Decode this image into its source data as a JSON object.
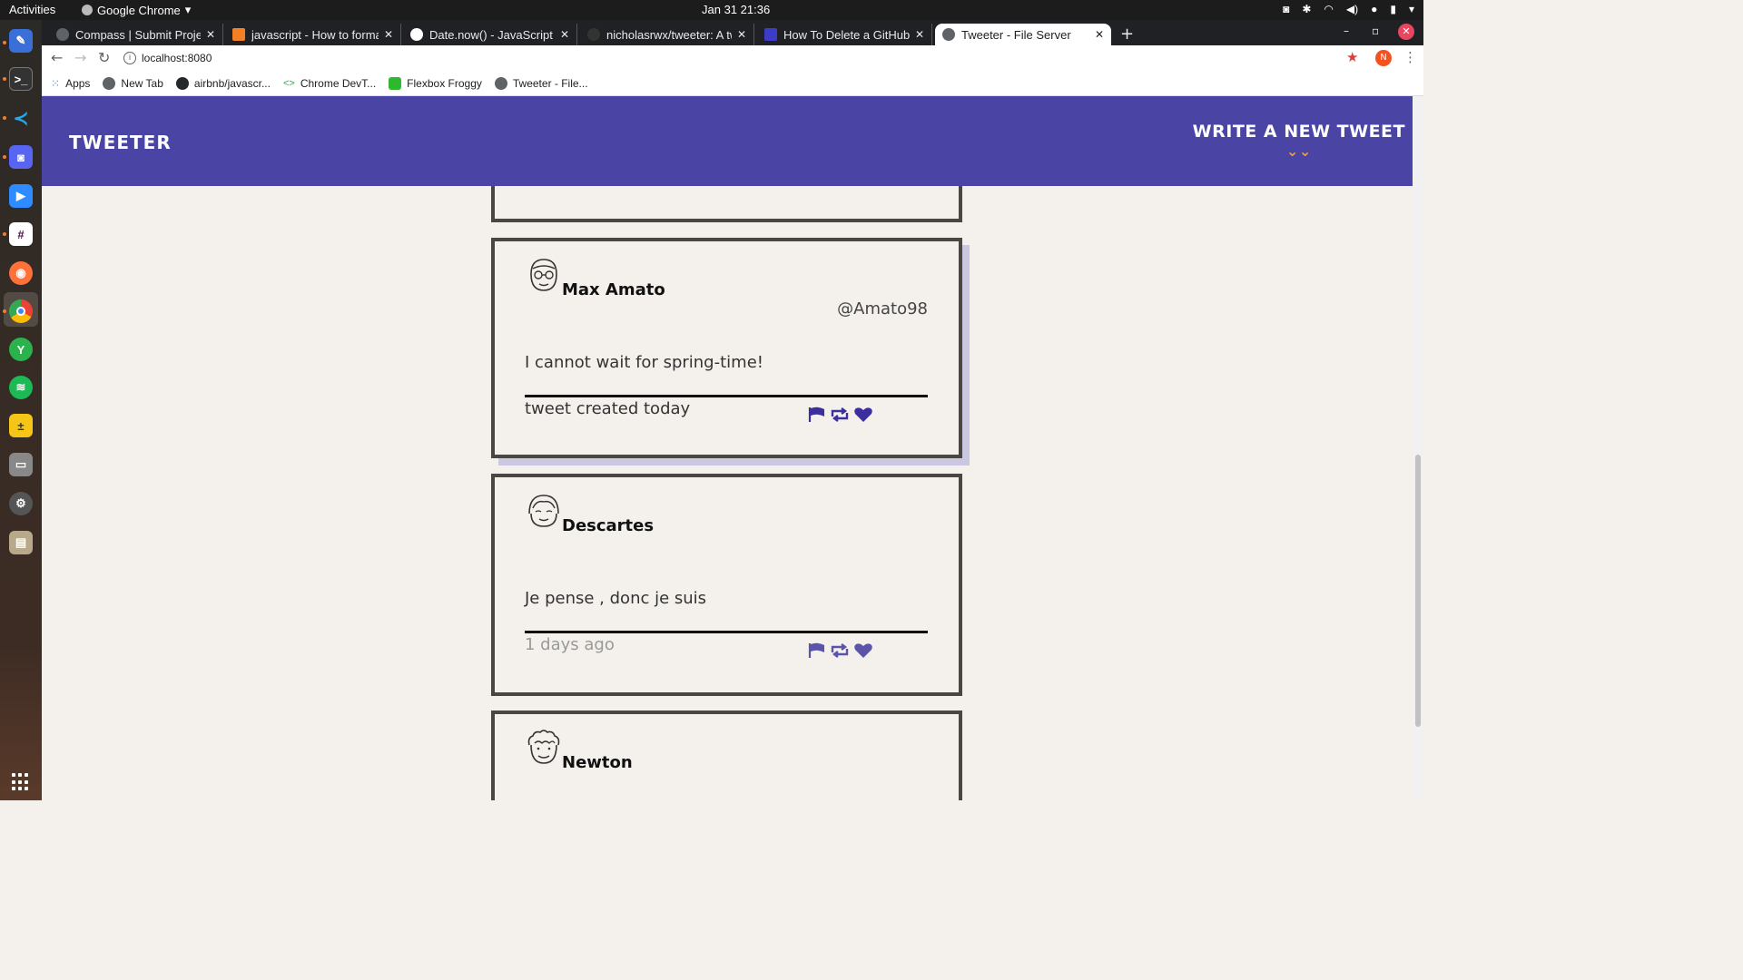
{
  "os": {
    "activities": "Activities",
    "app_name": "Google Chrome",
    "clock": "Jan 31  21:36"
  },
  "browser": {
    "tabs": [
      {
        "title": "Compass | Submit Project"
      },
      {
        "title": "javascript - How to format"
      },
      {
        "title": "Date.now() - JavaScript | M"
      },
      {
        "title": "nicholasrwx/tweeter: A tw"
      },
      {
        "title": "How To Delete a GitHub R"
      },
      {
        "title": "Tweeter - File Server"
      }
    ],
    "url": "localhost:8080",
    "profile_initial": "N",
    "bookmarks": [
      {
        "label": "Apps"
      },
      {
        "label": "New Tab"
      },
      {
        "label": "airbnb/javascr..."
      },
      {
        "label": "Chrome DevT..."
      },
      {
        "label": "Flexbox Froggy"
      },
      {
        "label": "Tweeter - File..."
      }
    ]
  },
  "site": {
    "brand": "TWEETER",
    "write_new_label": "WRITE A NEW TWEET",
    "accent_color": "#4a45a5",
    "chevron_color": "#f0a030"
  },
  "tweets": [
    {
      "name": "Max Amato",
      "handle": "@Amato98",
      "text": "I cannot wait for spring-time!",
      "time": "tweet created today",
      "avatar_icon": "glasses-face-icon"
    },
    {
      "name": "Descartes",
      "handle": "",
      "text": "Je pense , donc je suis",
      "time": "1 days ago",
      "avatar_icon": "bangs-face-icon"
    },
    {
      "name": "Newton",
      "handle": "",
      "text": "",
      "time": "",
      "avatar_icon": "curly-hair-face-icon"
    }
  ]
}
